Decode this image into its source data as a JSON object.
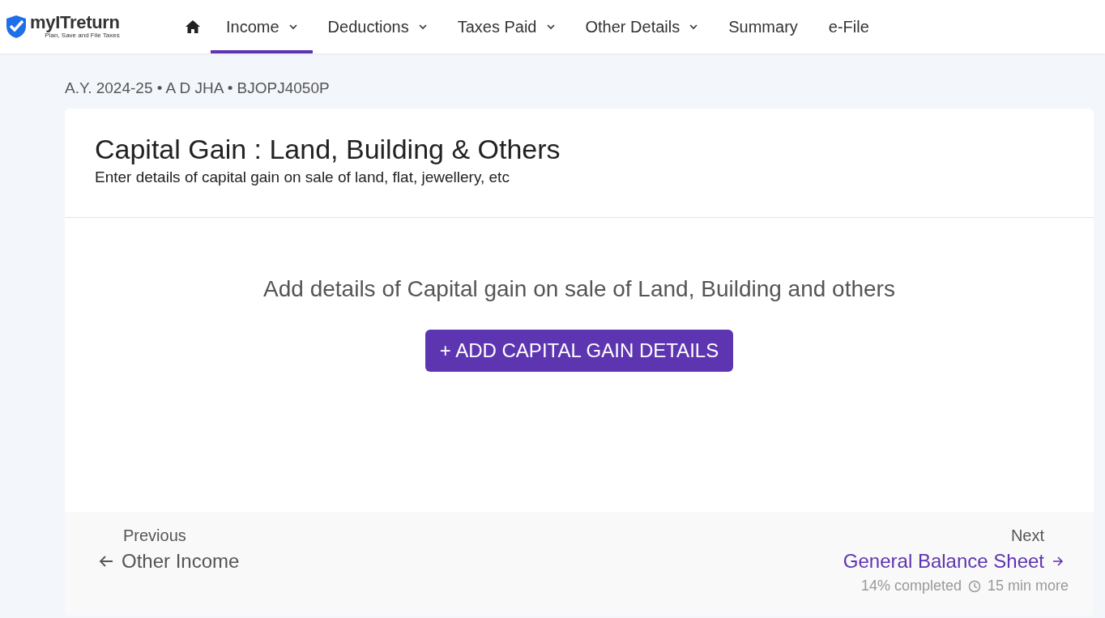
{
  "logo": {
    "name": "myITreturn",
    "tagline": "Plan, Save and File Taxes"
  },
  "nav": [
    {
      "kind": "home",
      "selected": false
    },
    {
      "kind": "menu",
      "label": "Income",
      "dropdown": true,
      "selected": true
    },
    {
      "kind": "menu",
      "label": "Deductions",
      "dropdown": true,
      "selected": false
    },
    {
      "kind": "menu",
      "label": "Taxes Paid",
      "dropdown": true,
      "selected": false
    },
    {
      "kind": "menu",
      "label": "Other Details",
      "dropdown": true,
      "selected": false
    },
    {
      "kind": "menu",
      "label": "Summary",
      "dropdown": false,
      "selected": false
    },
    {
      "kind": "menu",
      "label": "e-File",
      "dropdown": false,
      "selected": false
    }
  ],
  "breadcrumb": "A.Y. 2024-25 • A D JHA • BJOPJ4050P",
  "card": {
    "title": "Capital Gain : Land, Building & Others",
    "subtitle": "Enter details of capital gain on sale of land, flat, jewellery, etc",
    "empty_message": "Add details of Capital gain on sale of Land, Building and others",
    "add_button": "+ ADD CAPITAL GAIN DETAILS"
  },
  "footer": {
    "previous_label": "Previous",
    "previous_link": "Other Income",
    "next_label": "Next",
    "next_link": "General Balance Sheet",
    "progress": "14% completed",
    "time_left": "15 min more"
  }
}
